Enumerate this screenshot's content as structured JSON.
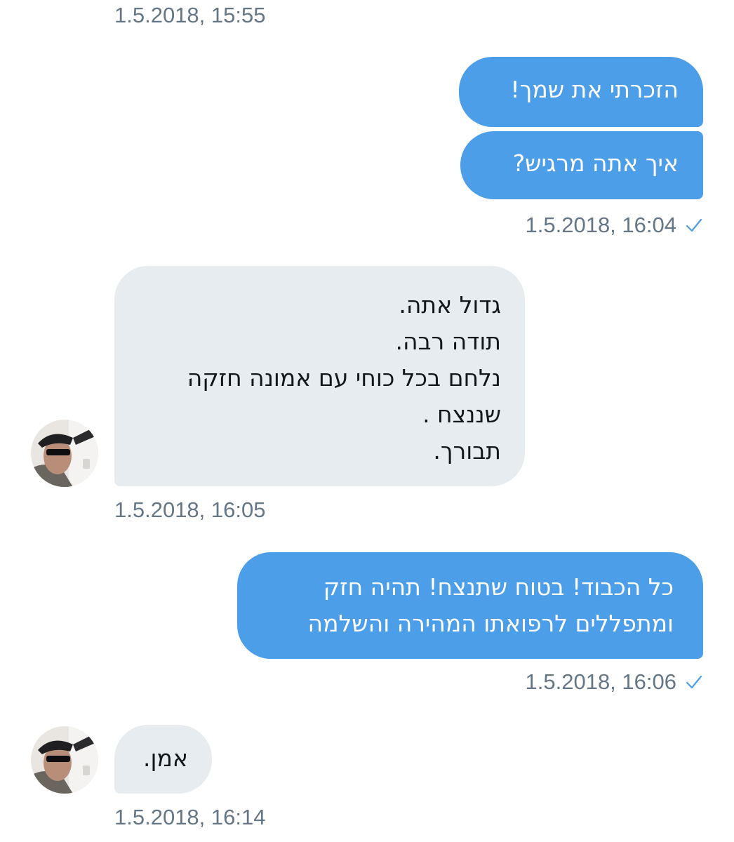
{
  "conversation": {
    "messages": [
      {
        "timestamp": "1.5.2018, 15:55"
      },
      {
        "sender": "me",
        "bubbles": [
          "הזכרתי את שמך!",
          "איך אתה מרגיש?"
        ],
        "timestamp": "1.5.2018, 16:04",
        "read_receipt": "check-icon"
      },
      {
        "sender": "contact",
        "lines": [
          "גדול אתה.",
          "תודה רבה.",
          "נלחם בכל כוחי עם אמונה חזקה",
          "שננצח .",
          "תבורך."
        ],
        "timestamp": "1.5.2018, 16:05",
        "avatar": "avatar-photo"
      },
      {
        "sender": "me",
        "lines": [
          "כל הכבוד! בטוח שתנצח! תהיה חזק",
          "ומתפללים לרפואתו המהירה והשלמה"
        ],
        "timestamp": "1.5.2018, 16:06",
        "read_receipt": "check-icon"
      },
      {
        "sender": "contact",
        "lines": [
          "אמן."
        ],
        "timestamp": "1.5.2018, 16:14",
        "avatar": "avatar-photo"
      }
    ]
  },
  "colors": {
    "outgoing_bubble": "#4d9ee9",
    "incoming_bubble": "#e6ecf0",
    "timestamp": "#657786",
    "check": "#4d9ee9"
  }
}
